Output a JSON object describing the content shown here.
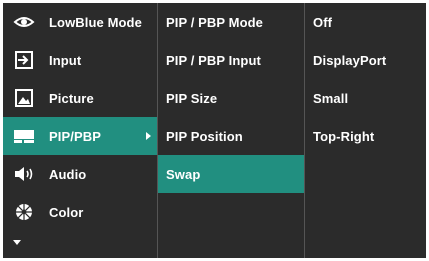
{
  "main_menu": {
    "items": [
      {
        "label": "LowBlue Mode",
        "icon": "eye-icon"
      },
      {
        "label": "Input",
        "icon": "input-arrow-icon"
      },
      {
        "label": "Picture",
        "icon": "picture-icon"
      },
      {
        "label": "PIP/PBP",
        "icon": "pip-pbp-icon",
        "selected": true
      },
      {
        "label": "Audio",
        "icon": "speaker-icon"
      },
      {
        "label": "Color",
        "icon": "color-wheel-icon"
      }
    ],
    "more_indicator": "chevron-down-icon"
  },
  "submenu": {
    "items": [
      {
        "label": "PIP / PBP Mode"
      },
      {
        "label": "PIP / PBP Input"
      },
      {
        "label": "PIP Size"
      },
      {
        "label": "PIP Position"
      },
      {
        "label": "Swap",
        "highlighted": true
      }
    ]
  },
  "values": {
    "items": [
      {
        "label": "Off"
      },
      {
        "label": "DisplayPort"
      },
      {
        "label": "Small"
      },
      {
        "label": "Top-Right"
      }
    ]
  },
  "colors": {
    "background": "#2b2b2b",
    "highlight": "#218f80",
    "text": "#ffffff",
    "separator": "#555555"
  }
}
